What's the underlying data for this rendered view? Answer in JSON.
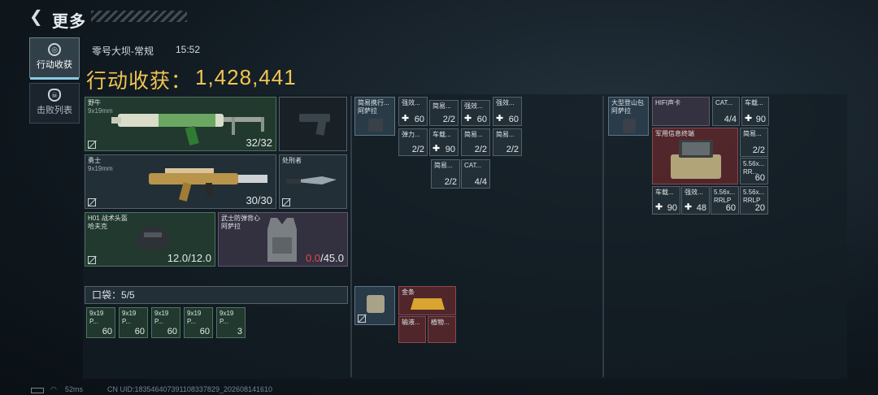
{
  "header": {
    "back_icon": "chevron-left-icon",
    "title": "更多"
  },
  "tabs": [
    {
      "label": "行动收获",
      "icon": "target-icon",
      "active": true
    },
    {
      "label": "击败列表",
      "icon": "skull-icon",
      "active": false
    }
  ],
  "match": {
    "map": "零号大坝-常规",
    "time": "15:52"
  },
  "haul": {
    "label": "行动收获：",
    "value": "1,428,441",
    "color": "#f2c552"
  },
  "loadout": {
    "primary": {
      "name": "野牛",
      "ammo": "9x19mm",
      "count": "32/32"
    },
    "secondary": {
      "name": "勇士",
      "ammo": "9x19mm",
      "count": "30/30"
    },
    "melee": {
      "name": "处刑者"
    },
    "helmet": {
      "name": "H01 战术头盔",
      "sub": "哈夫克",
      "durability": "12.0/12.0"
    },
    "vest": {
      "name": "武士防弹背心",
      "sub": "阿萨拉",
      "durability_current": "0.0",
      "durability_max": "/45.0"
    },
    "pocket_label": "口袋：",
    "pocket_count": "5/5",
    "pocket_items": [
      {
        "name": "9x19",
        "sub": "P...",
        "qty": "60"
      },
      {
        "name": "9x19",
        "sub": "P...",
        "qty": "60"
      },
      {
        "name": "9x19",
        "sub": "P...",
        "qty": "60"
      },
      {
        "name": "9x19",
        "sub": "P...",
        "qty": "60"
      },
      {
        "name": "9x19",
        "sub": "P...",
        "qty": "3"
      }
    ]
  },
  "chest_rig": {
    "name": "简易携行...",
    "sub": "阿萨拉",
    "items": [
      {
        "name": "强效...",
        "qty": "60"
      },
      {
        "name": "简易...",
        "qty": "2/2"
      },
      {
        "name": "强效...",
        "qty": "60"
      },
      {
        "name": "强效...",
        "qty": "60"
      },
      {
        "name": "弹力...",
        "qty": "2/2"
      },
      {
        "name": "车载...",
        "qty": "90"
      },
      {
        "name": "简易...",
        "qty": "2/2"
      },
      {
        "name": "简易...",
        "qty": "2/2"
      },
      {
        "name": "简易...",
        "qty": "2/2"
      },
      {
        "name": "CAT...",
        "qty": "4/4"
      }
    ]
  },
  "safe_box": {
    "items": [
      {
        "name": "金条"
      },
      {
        "name": "输液..."
      },
      {
        "name": "植物..."
      }
    ]
  },
  "backpack": {
    "name": "大型登山包",
    "sub": "阿萨拉",
    "items": [
      {
        "name": "HIFI声卡"
      },
      {
        "name": "CAT...",
        "qty": "4/4"
      },
      {
        "name": "车载...",
        "qty": "90"
      },
      {
        "name": "军用信息终端"
      },
      {
        "name": "简易...",
        "qty": "2/2"
      },
      {
        "name": "5.56x...",
        "sub": "RR...",
        "qty": "60"
      },
      {
        "name": "车载...",
        "qty": "90"
      },
      {
        "name": "强效...",
        "qty": "48"
      },
      {
        "name": "5.56x...",
        "sub": "RRLP",
        "qty": "60"
      },
      {
        "name": "5.56x...",
        "sub": "RRLP",
        "qty": "20"
      }
    ]
  },
  "footer": {
    "ping": "52ms",
    "uid": "CN UID:183546407391108337829_202608141610"
  }
}
